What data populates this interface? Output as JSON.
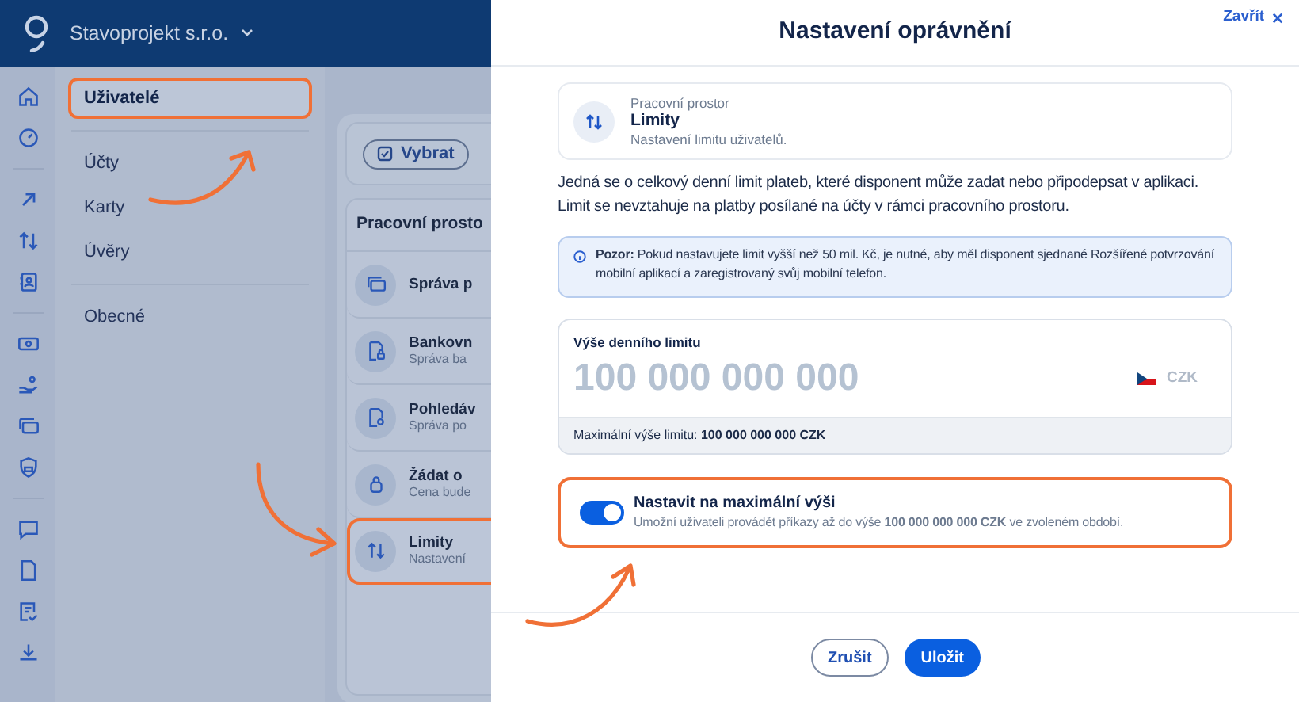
{
  "header": {
    "company": "Stavoprojekt s.r.o."
  },
  "nav": {
    "groups": [
      [
        {
          "label": "Uživatelé",
          "selected": true,
          "highlighted": true
        }
      ],
      [
        {
          "label": "Účty",
          "selected": false,
          "highlighted": false
        },
        {
          "label": "Karty",
          "selected": false,
          "highlighted": false
        },
        {
          "label": "Úvěry",
          "selected": false,
          "highlighted": false
        }
      ],
      [
        {
          "label": "Obecné",
          "selected": false,
          "highlighted": false
        }
      ]
    ]
  },
  "content": {
    "select_button": "Vybrat",
    "panel_title": "Pracovní prosto",
    "rows": [
      {
        "kind": "cards",
        "title": "Správa p",
        "highlighted": false
      },
      {
        "kind": "bank",
        "title": "Bankovn",
        "subtitle": "Správa ba",
        "highlighted": false
      },
      {
        "kind": "receivable",
        "title": "Pohledáv",
        "subtitle": "Správa po",
        "highlighted": false
      },
      {
        "kind": "lock",
        "title": "Žádat o",
        "subtitle": "Cena bude",
        "highlighted": false
      },
      {
        "kind": "limits",
        "title": "Limity",
        "subtitle": "Nastavení",
        "highlighted": true
      }
    ]
  },
  "modal": {
    "title": "Nastavení oprávnění",
    "close": "Zavřít",
    "workspace": {
      "label": "Pracovní prostor",
      "title": "Limity",
      "description": "Nastavení limitu uživatelů."
    },
    "intro": "Jedná se o celkový denní limit plateb, které disponent může zadat nebo připodepsat v aplikaci. Limit se nevztahuje na platby posílané na účty v rámci pracovního prostoru.",
    "notice": "**Pozor:** Pokud nastavujete limit vyšší než 50 mil. Kč, je nutné, aby měl disponent sjednané Rozšířené potvrzování mobilní aplikací a zaregistrovaný svůj mobilní telefon.",
    "amount": {
      "label": "Výše denního limitu",
      "value": "100 000 000 000",
      "currency": "CZK",
      "disabled": true,
      "footnote": "Maximální výše limitu: **100 000 000 000 CZK**"
    },
    "toggle": {
      "title": "Nastavit na maximální výši",
      "description": "Umožní uživateli provádět příkazy až do výše **100 000 000 000 CZK** ve zvoleném období.",
      "on": true,
      "highlighted": true
    },
    "buttons": {
      "cancel": "Zrušit",
      "save": "Uložit"
    }
  }
}
